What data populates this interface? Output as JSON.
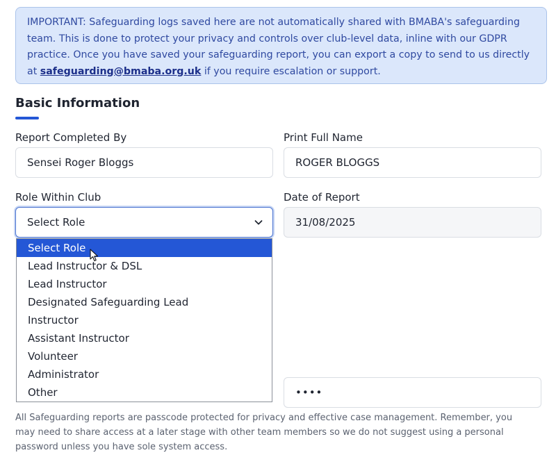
{
  "notice": {
    "text_before": "IMPORTANT: Safeguarding logs saved here are not automatically shared with BMABA's safeguarding team. This is done to protect your privacy and controls over club-level data, inline with our GDPR practice. Once you have saved your safeguarding report, you can export a copy to send to us directly at ",
    "email": "safeguarding@bmaba.org.uk",
    "text_after": " if you require escalation or support."
  },
  "section": {
    "title": "Basic Information"
  },
  "form": {
    "completed_by": {
      "label": "Report Completed By",
      "value": "Sensei Roger Bloggs"
    },
    "full_name": {
      "label": "Print Full Name",
      "value": "ROGER BLOGGS"
    },
    "role": {
      "label": "Role Within Club",
      "value": "Select Role",
      "options": [
        "Select Role",
        "Lead Instructor & DSL",
        "Lead Instructor",
        "Designated Safeguarding Lead",
        "Instructor",
        "Assistant Instructor",
        "Volunteer",
        "Administrator",
        "Other"
      ],
      "highlighted_option": "Select Role"
    },
    "date": {
      "label": "Date of Report",
      "value": "31/08/2025"
    },
    "passcode": {
      "value": "••••"
    },
    "helper": "All Safeguarding reports are passcode protected for privacy and effective case management. Remember, you may need to share access at a later stage with other team members so we do not suggest using a personal password unless you have sole system access."
  },
  "colors": {
    "accent": "#2457d6",
    "notice_bg": "#dbe7fb",
    "notice_text": "#2f49a0"
  },
  "icons": {
    "select_chevron": "chevron-down-icon",
    "cursor": "mouse-pointer-icon"
  }
}
